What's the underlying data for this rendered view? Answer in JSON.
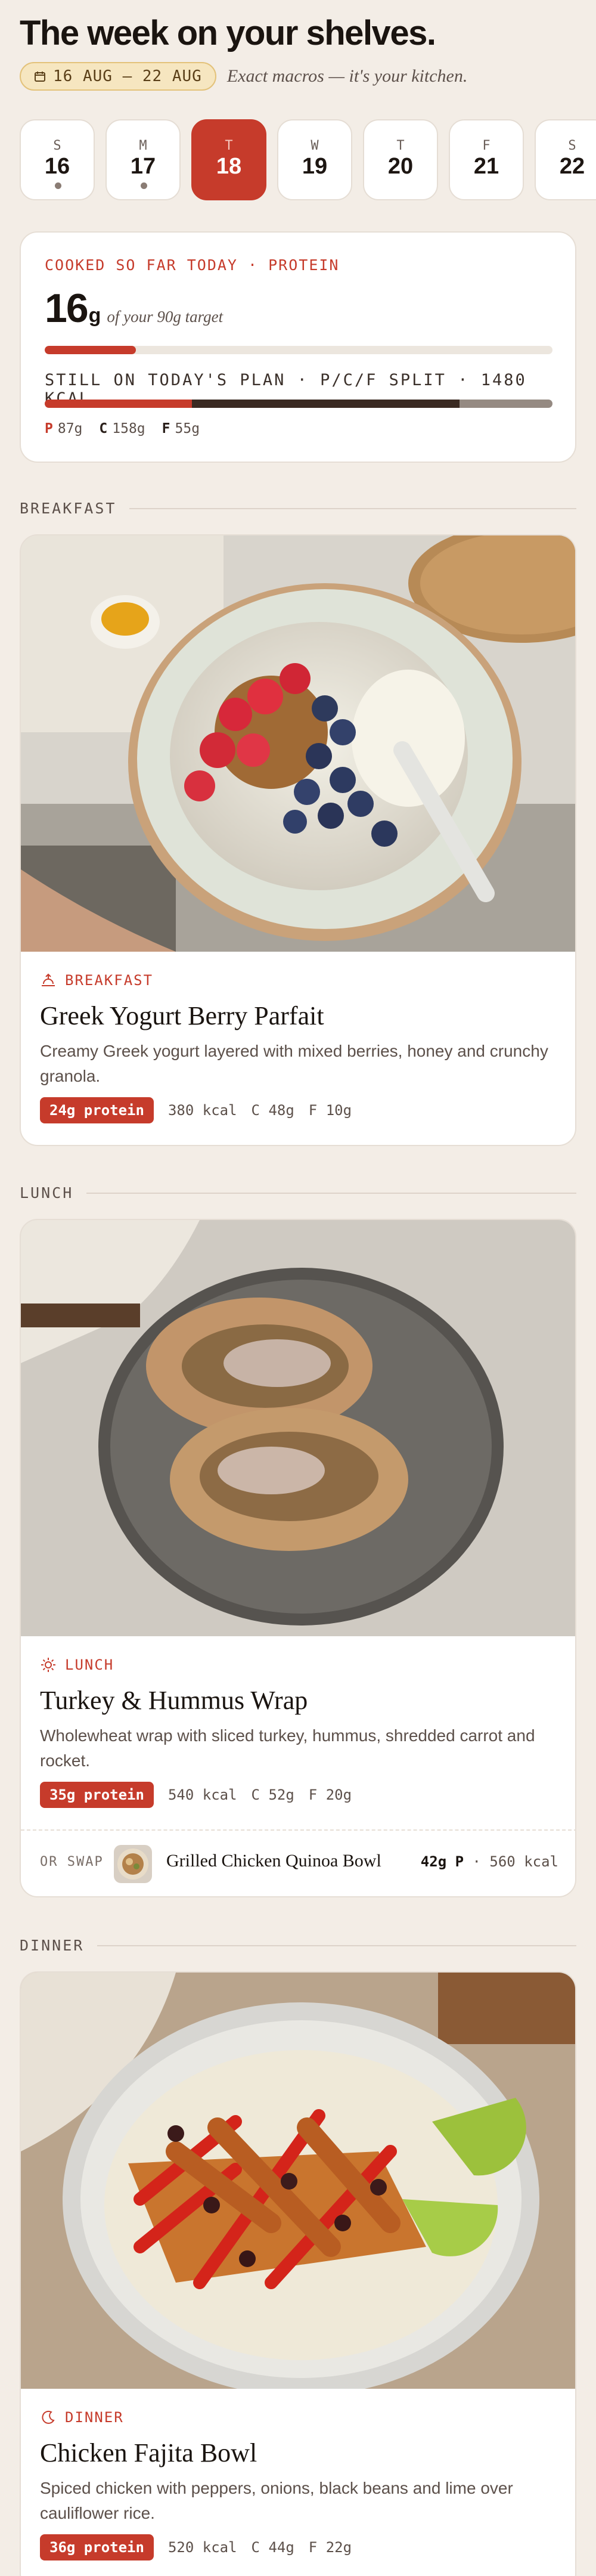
{
  "header": {
    "title": "The week on your shelves.",
    "date_range": "16 AUG — 22 AUG",
    "tagline": "Exact macros — it's your kitchen."
  },
  "days": [
    {
      "letter": "S",
      "num": "16",
      "dot": true,
      "active": false
    },
    {
      "letter": "M",
      "num": "17",
      "dot": true,
      "active": false
    },
    {
      "letter": "T",
      "num": "18",
      "dot": false,
      "active": true
    },
    {
      "letter": "W",
      "num": "19",
      "dot": false,
      "active": false
    },
    {
      "letter": "T",
      "num": "20",
      "dot": false,
      "active": false
    },
    {
      "letter": "F",
      "num": "21",
      "dot": false,
      "active": false
    },
    {
      "letter": "S",
      "num": "22",
      "dot": false,
      "active": false
    }
  ],
  "summary": {
    "eyebrow": "COOKED SO FAR TODAY · PROTEIN",
    "cooked_num": "16",
    "cooked_unit": "g",
    "target_text": "of your 90g target",
    "cooked_fraction": 0.18,
    "plan_text": "STILL ON TODAY'S PLAN · P/C/F SPLIT · 1480 KCAL",
    "split": {
      "p": 87,
      "c": 158,
      "f": 55
    },
    "legend": {
      "p_label": "P",
      "p_value": "87g",
      "c_label": "C",
      "c_value": "158g",
      "f_label": "F",
      "f_value": "55g"
    }
  },
  "sections": {
    "breakfast": "BREAKFAST",
    "lunch": "LUNCH",
    "dinner": "DINNER"
  },
  "meals": {
    "breakfast": {
      "eyebrow": "BREAKFAST",
      "name": "Greek Yogurt Berry Parfait",
      "desc": "Creamy Greek yogurt layered with mixed berries, honey and crunchy granola.",
      "protein": "24g protein",
      "kcal": "380 kcal",
      "carbs": "C 48g",
      "fat": "F 10g"
    },
    "lunch": {
      "eyebrow": "LUNCH",
      "name": "Turkey & Hummus Wrap",
      "desc": "Wholewheat wrap with sliced turkey, hummus, shredded carrot and rocket.",
      "protein": "35g protein",
      "kcal": "540 kcal",
      "carbs": "C 52g",
      "fat": "F 20g",
      "swap": {
        "label": "OR SWAP",
        "name": "Grilled Chicken Quinoa Bowl",
        "protein": "42g P",
        "kcal": "· 560 kcal"
      }
    },
    "dinner": {
      "eyebrow": "DINNER",
      "name": "Chicken Fajita Bowl",
      "desc": "Spiced chicken with peppers, onions, black beans and lime over cauliflower rice.",
      "protein": "36g protein",
      "kcal": "520 kcal",
      "carbs": "C 44g",
      "fat": "F 22g"
    }
  },
  "colors": {
    "accent": "#c63b2b",
    "background": "#f3ede6",
    "dark": "#3a2a22",
    "muted": "#958a82"
  },
  "icons": {
    "date_pill": "calendar-icon",
    "breakfast": "sunrise-icon",
    "lunch": "sun-icon",
    "dinner": "moon-icon"
  }
}
